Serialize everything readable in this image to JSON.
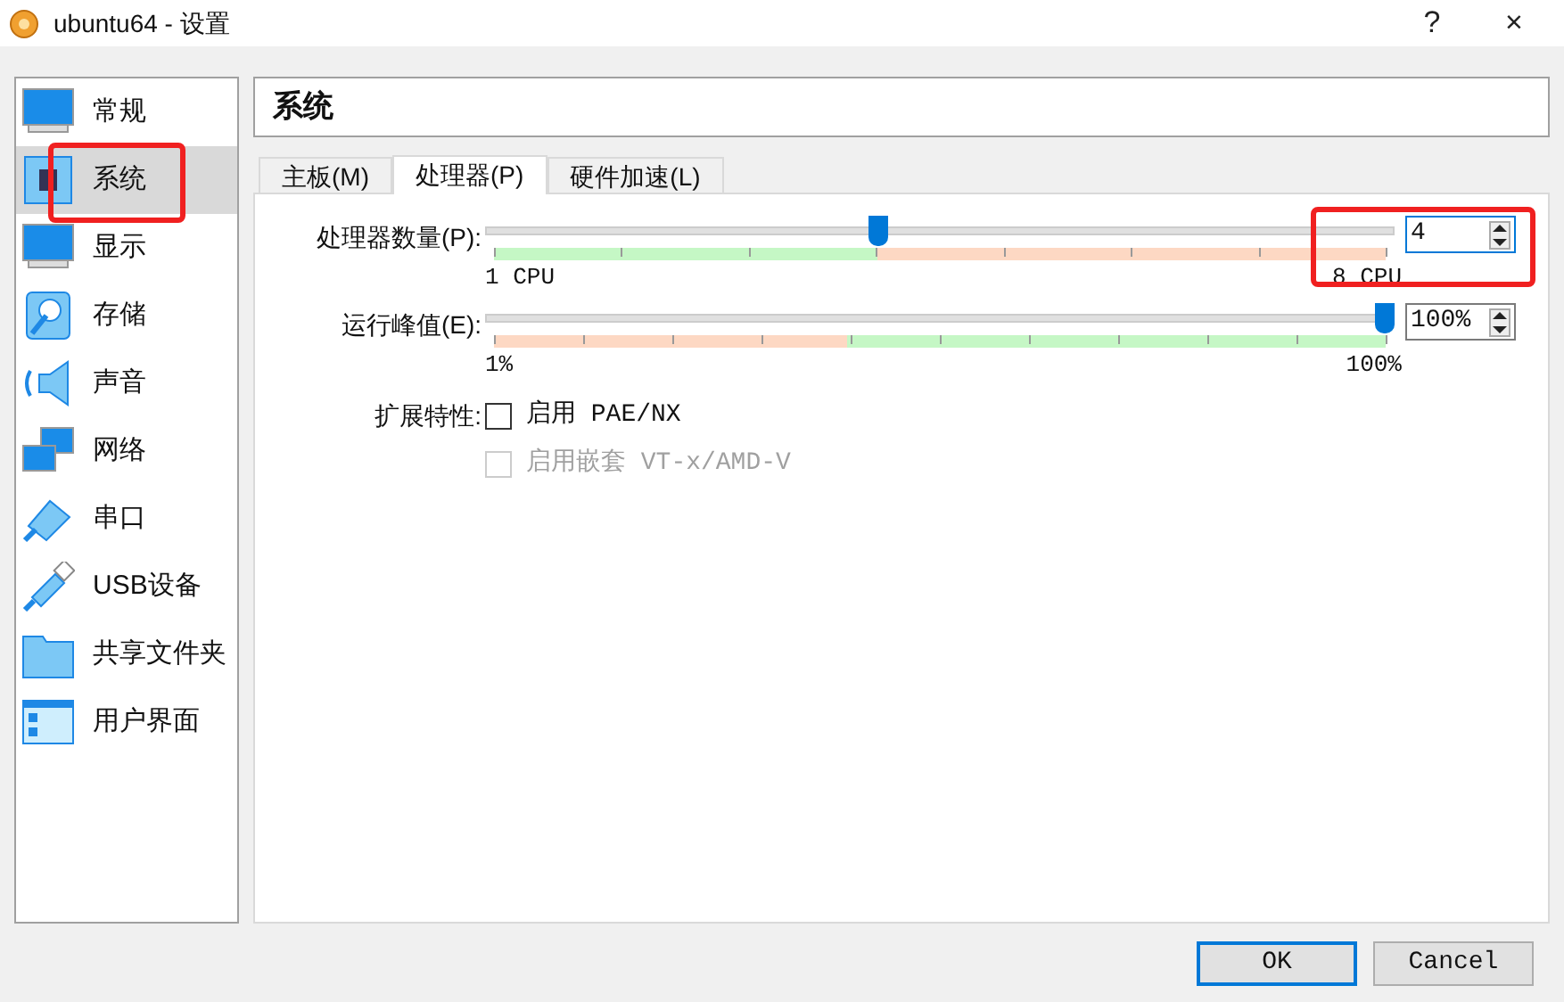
{
  "window": {
    "title": "ubuntu64 - 设置",
    "buttons": [
      "?",
      "×"
    ]
  },
  "sidebar": {
    "items": [
      {
        "label": "常规",
        "kind": "monitor",
        "selected": false
      },
      {
        "label": "系统",
        "kind": "chip",
        "selected": true
      },
      {
        "label": "显示",
        "kind": "monitor",
        "selected": false
      },
      {
        "label": "存储",
        "kind": "disk",
        "selected": false
      },
      {
        "label": "声音",
        "kind": "speaker",
        "selected": false
      },
      {
        "label": "网络",
        "kind": "network",
        "selected": false
      },
      {
        "label": "串口",
        "kind": "plug",
        "selected": false
      },
      {
        "label": "USB设备",
        "kind": "usb",
        "selected": false
      },
      {
        "label": "共享文件夹",
        "kind": "folder",
        "selected": false
      },
      {
        "label": "用户界面",
        "kind": "window",
        "selected": false
      }
    ]
  },
  "section_title": "系统",
  "tabs": [
    {
      "label": "主板(M)",
      "selected": false
    },
    {
      "label": "处理器(P)",
      "selected": true
    },
    {
      "label": "硬件加速(L)",
      "selected": false
    }
  ],
  "sliders": [
    {
      "label": "处理器数量(P):",
      "level": 0.43,
      "min_label": "1 CPU",
      "max_label": "8 CPU",
      "value": "4",
      "focused": true
    },
    {
      "label": "运行峰值(E):",
      "level": 1,
      "min_label": "1%",
      "max_label": "100%",
      "value": "100%",
      "focused": false
    }
  ],
  "extended": {
    "label": "扩展特性:",
    "options": [
      {
        "label": "启用 PAE/NX",
        "checked": false,
        "disabled": false
      },
      {
        "label": "启用嵌套 VT-x/AMD-V",
        "checked": false,
        "disabled": true
      }
    ]
  },
  "buttons": [
    {
      "label": "OK",
      "default": true
    },
    {
      "label": "Cancel",
      "default": false
    }
  ]
}
